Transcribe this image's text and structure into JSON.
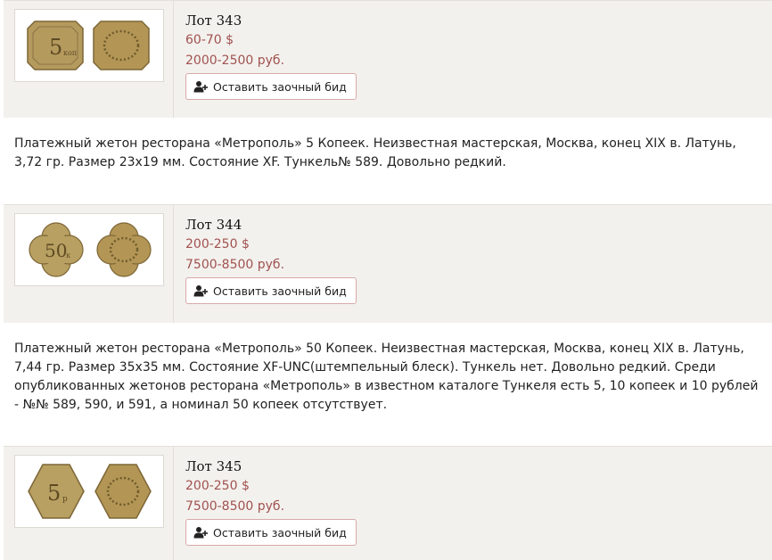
{
  "lots": [
    {
      "title": "Лот 343",
      "price_usd": "60-70 $",
      "price_rub": "2000-2500 руб.",
      "bid_label": "Оставить заочный бид",
      "obverse_mark": "5",
      "obverse_sub": "коп",
      "description": "Платежный жетон ресторана «Метрополь» 5 Копеек. Неизвестная мастерская, Москва, конец XIX в. Латунь, 3,72 гр. Размер 23х19 мм. Состояние XF. Тункель№ 589. Довольно редкий."
    },
    {
      "title": "Лот 344",
      "price_usd": "200-250 $",
      "price_rub": "7500-8500 руб.",
      "bid_label": "Оставить заочный бид",
      "obverse_mark": "50",
      "obverse_sub": "к",
      "description": "Платежный жетон ресторана «Метрополь» 50 Копеек. Неизвестная мастерская, Москва, конец XIX в. Латунь, 7,44 гр. Размер 35х35 мм. Состояние XF-UNC(штемпельный блеск). Тункель нет. Довольно редкий. Среди опубликованных жетонов ресторана «Метрополь» в известном каталоге Тункеля есть 5, 10 копеек и 10 рублей - №№ 589, 590, и 591, а номинал 50 копеек отсутствует."
    },
    {
      "title": "Лот 345",
      "price_usd": "200-250 $",
      "price_rub": "7500-8500 руб.",
      "bid_label": "Оставить заочный бид",
      "obverse_mark": "5",
      "obverse_sub": "р"
    }
  ],
  "colors": {
    "price": "#a0524f",
    "row_bg": "#f3f1ee",
    "button_border": "#d7a9a7",
    "coin_brass": "#b59a5e"
  },
  "icons": {
    "bid": "add-user-icon"
  }
}
